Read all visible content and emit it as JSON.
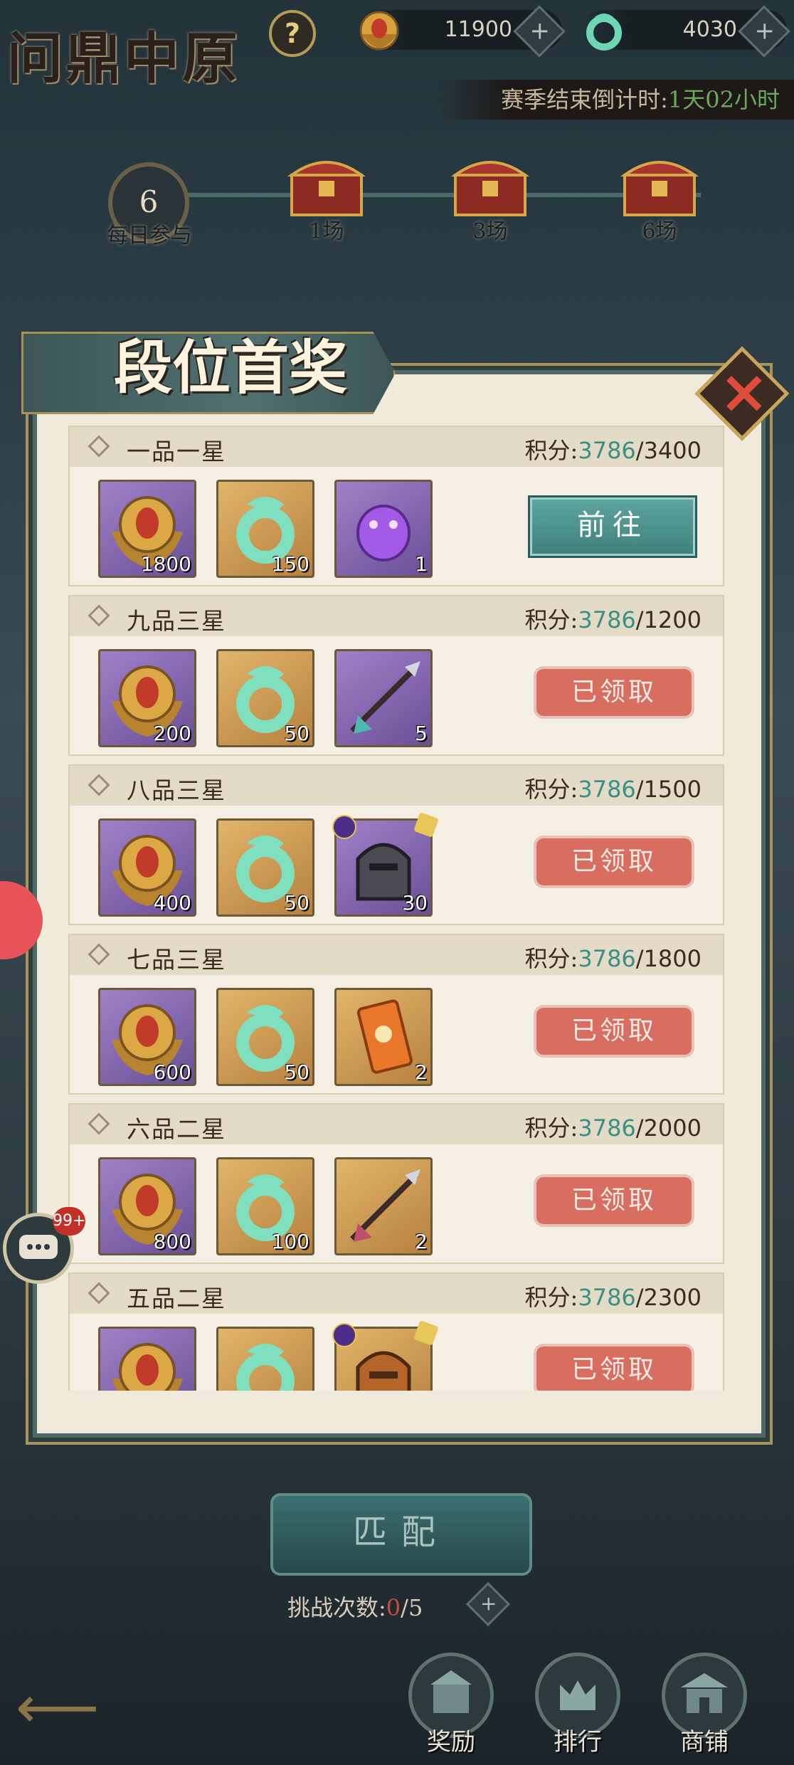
{
  "header": {
    "title": "问鼎中原",
    "help_symbol": "?",
    "gold_amount": "11900",
    "jade_amount": "4030",
    "plus_symbol": "+",
    "season_label": "赛季结束倒计时:",
    "season_time": "1天02小时"
  },
  "daily": {
    "count": "6",
    "label": "每日参与",
    "milestones": [
      {
        "label": "1场"
      },
      {
        "label": "3场"
      },
      {
        "label": "6场"
      }
    ]
  },
  "panel": {
    "title": "段位首奖",
    "close_symbol": "×",
    "score_prefix": "积分:",
    "rows": [
      {
        "rank": "一品一星",
        "current": "3786",
        "target": "/3400",
        "button": "前往",
        "state": "go",
        "items": [
          {
            "icon": "gold-medal-icon",
            "count": "1800"
          },
          {
            "icon": "jade-dragon-icon",
            "count": "150"
          },
          {
            "icon": "purple-beast-icon",
            "count": "1"
          }
        ]
      },
      {
        "rank": "九品三星",
        "current": "3786",
        "target": "/1200",
        "button": "已领取",
        "state": "claimed",
        "items": [
          {
            "icon": "gold-medal-icon",
            "count": "200"
          },
          {
            "icon": "jade-dragon-icon",
            "count": "50"
          },
          {
            "icon": "spear-icon",
            "count": "5"
          }
        ]
      },
      {
        "rank": "八品三星",
        "current": "3786",
        "target": "/1500",
        "button": "已领取",
        "state": "claimed",
        "items": [
          {
            "icon": "gold-medal-icon",
            "count": "400"
          },
          {
            "icon": "jade-dragon-icon",
            "count": "50"
          },
          {
            "icon": "helmet-fragment-icon",
            "count": "30"
          }
        ]
      },
      {
        "rank": "七品三星",
        "current": "3786",
        "target": "/1800",
        "button": "已领取",
        "state": "claimed",
        "items": [
          {
            "icon": "gold-medal-icon",
            "count": "600"
          },
          {
            "icon": "jade-dragon-icon",
            "count": "50"
          },
          {
            "icon": "talisman-card-icon",
            "count": "2"
          }
        ]
      },
      {
        "rank": "六品二星",
        "current": "3786",
        "target": "/2000",
        "button": "已领取",
        "state": "claimed",
        "items": [
          {
            "icon": "gold-medal-icon",
            "count": "800"
          },
          {
            "icon": "jade-dragon-icon",
            "count": "100"
          },
          {
            "icon": "spear-icon",
            "count": "2"
          }
        ]
      },
      {
        "rank": "五品二星",
        "current": "3786",
        "target": "/2300",
        "button": "已领取",
        "state": "claimed",
        "items": [
          {
            "icon": "gold-medal-icon",
            "count": ""
          },
          {
            "icon": "jade-dragon-icon",
            "count": ""
          },
          {
            "icon": "helmet-fragment-icon",
            "count": ""
          }
        ]
      }
    ]
  },
  "bottom": {
    "match_label": "匹配",
    "challenge_label": "挑战次数:",
    "challenge_used": "0",
    "challenge_total": "/5",
    "nav": [
      {
        "label": "奖励"
      },
      {
        "label": "排行"
      },
      {
        "label": "商铺"
      }
    ],
    "chat_unread": "99+"
  },
  "colors": {
    "accent_teal": "#3a8f86",
    "claimed_red": "#d86e60",
    "go_teal": "#4f938d",
    "used_red": "#d04a3c"
  }
}
